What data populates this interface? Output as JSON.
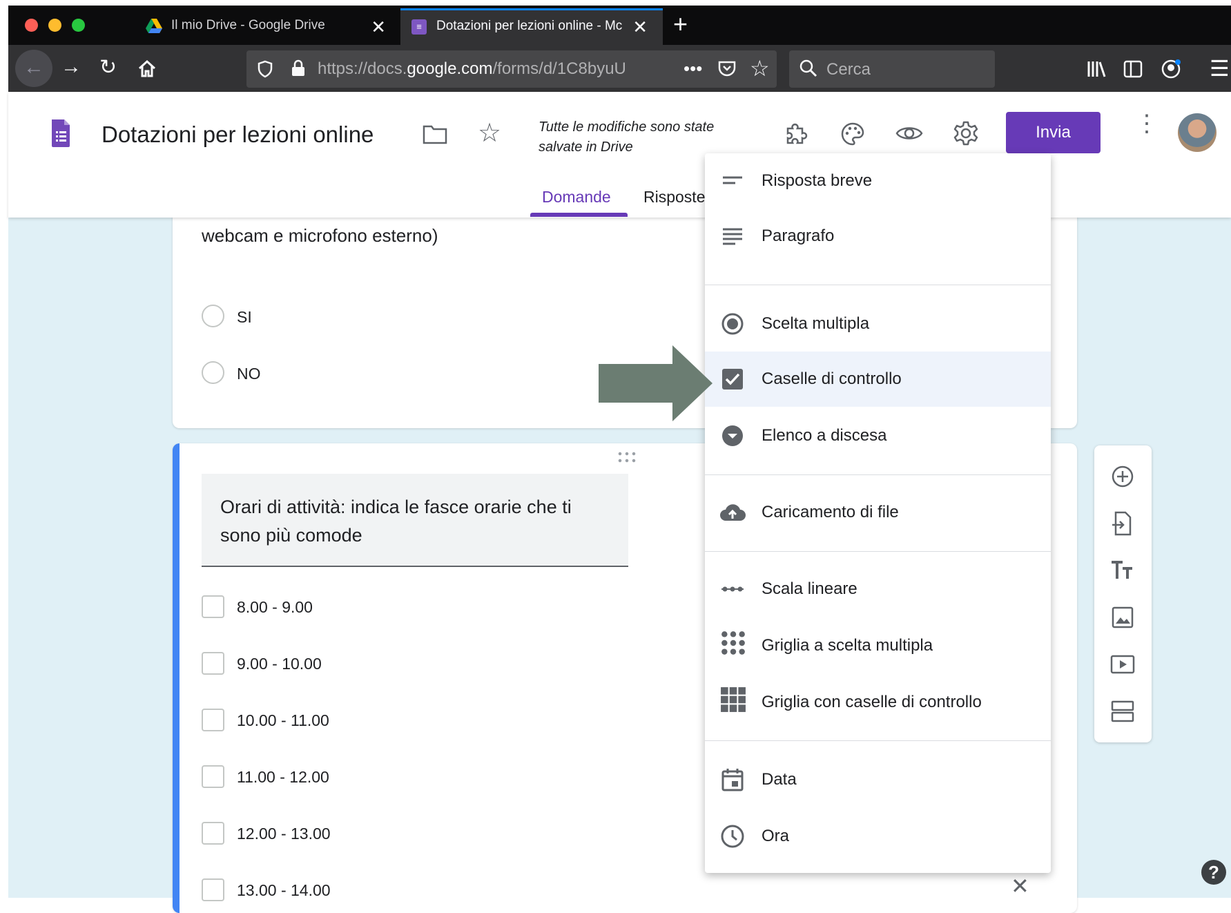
{
  "browser": {
    "tabs": [
      {
        "title": "Il mio Drive - Google Drive",
        "active": false
      },
      {
        "title": "Dotazioni per lezioni online - Mc",
        "active": true
      }
    ],
    "url_prefix": "https://docs.",
    "url_domain": "google.com",
    "url_path": "/forms/d/1C8byuU",
    "search_placeholder": "Cerca",
    "accent": "#0a84ff"
  },
  "header": {
    "doc_title": "Dotazioni per lezioni online",
    "saved_status": "Tutte le modifiche sono state salvate in Drive",
    "send_label": "Invia",
    "tabs": {
      "questions": "Domande",
      "responses": "Risposte"
    },
    "brand_color": "#673ab7"
  },
  "question1": {
    "title_tail": "webcam e microfono esterno)",
    "options": [
      "SI",
      "NO"
    ]
  },
  "question2": {
    "title": "Orari di attività: indica le fasce orarie che ti sono più comode",
    "options": [
      "8.00 - 9.00",
      "9.00 - 10.00",
      "10.00 - 11.00",
      "11.00 - 12.00",
      "12.00 - 13.00",
      "13.00 - 14.00"
    ]
  },
  "type_menu": {
    "items": [
      {
        "label": "Risposta breve",
        "icon": "short-text-icon"
      },
      {
        "label": "Paragrafo",
        "icon": "paragraph-icon"
      },
      {
        "label": "Scelta multipla",
        "icon": "radio-button-icon"
      },
      {
        "label": "Caselle di controllo",
        "icon": "checkbox-icon",
        "selected": true
      },
      {
        "label": "Elenco a discesa",
        "icon": "dropdown-icon"
      },
      {
        "label": "Caricamento di file",
        "icon": "cloud-upload-icon"
      },
      {
        "label": "Scala lineare",
        "icon": "linear-scale-icon"
      },
      {
        "label": "Griglia a scelta multipla",
        "icon": "multiple-choice-grid-icon"
      },
      {
        "label": "Griglia con caselle di controllo",
        "icon": "checkbox-grid-icon"
      },
      {
        "label": "Data",
        "icon": "calendar-icon"
      },
      {
        "label": "Ora",
        "icon": "clock-icon"
      }
    ]
  },
  "sidebar": {
    "tools": [
      "add-question-icon",
      "import-questions-icon",
      "add-title-icon",
      "add-image-icon",
      "add-video-icon",
      "add-section-icon"
    ]
  },
  "colors": {
    "content_background": "#e0f0f6",
    "active_card_border": "#4285f4",
    "annotation_arrow": "#6b7d72"
  }
}
